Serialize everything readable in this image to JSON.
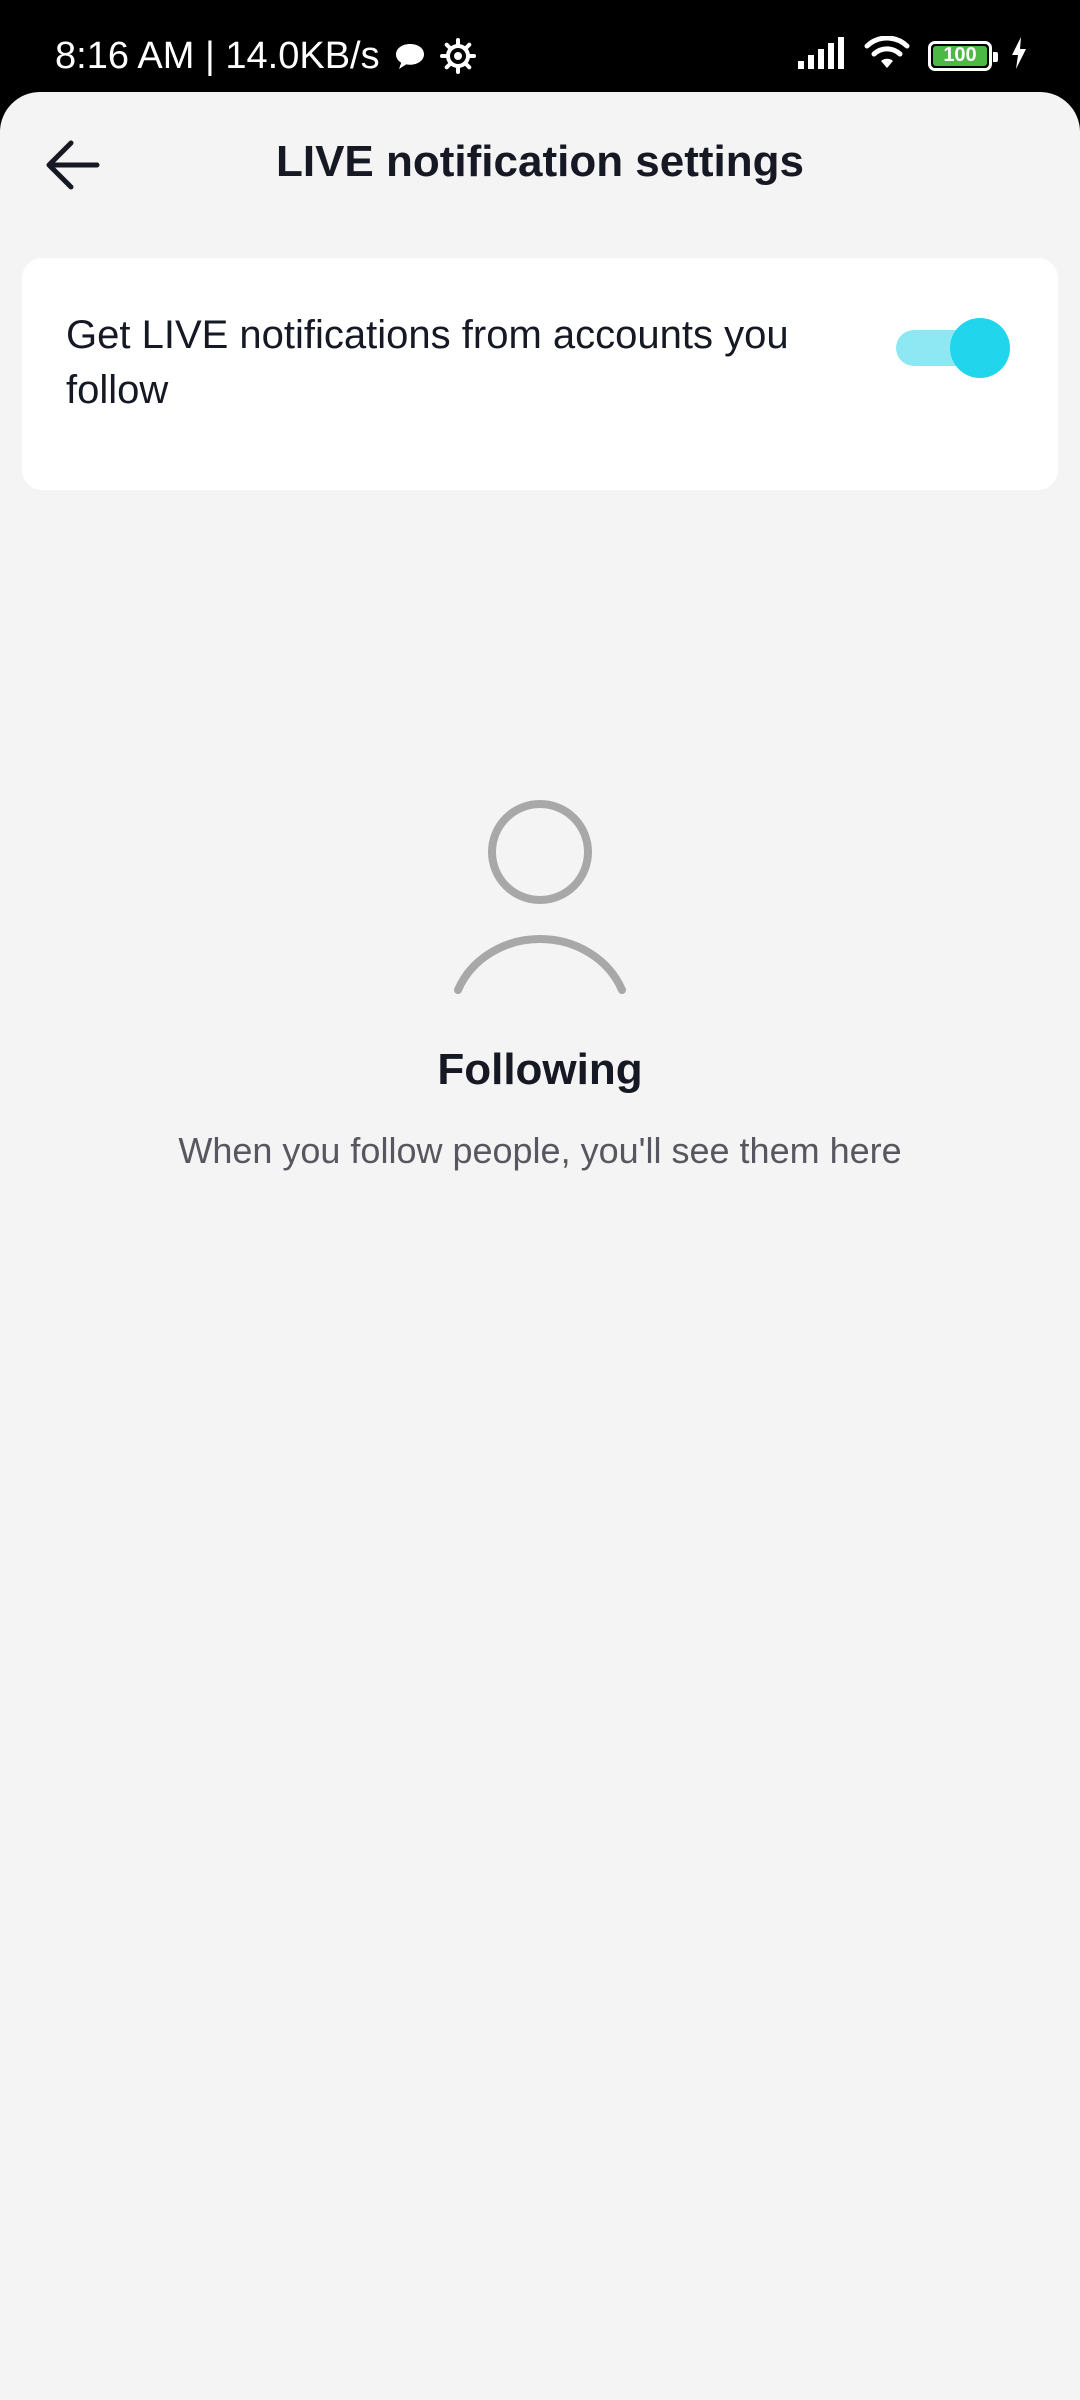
{
  "status_bar": {
    "time_speed": "8:16 AM | 14.0KB/s",
    "battery": "100",
    "icons": [
      "chat-bubble-icon",
      "settings-gear-icon",
      "signal-icon",
      "wifi-icon",
      "battery-icon",
      "charging-icon"
    ]
  },
  "header": {
    "title": "LIVE notification settings",
    "back_icon": "arrow-left-icon"
  },
  "setting": {
    "label": "Get LIVE notifications from accounts you follow",
    "enabled": true,
    "accent_color": "#20d5ec"
  },
  "empty_state": {
    "icon": "person-outline-icon",
    "title": "Following",
    "subtitle": "When you follow people, you'll see them here"
  }
}
